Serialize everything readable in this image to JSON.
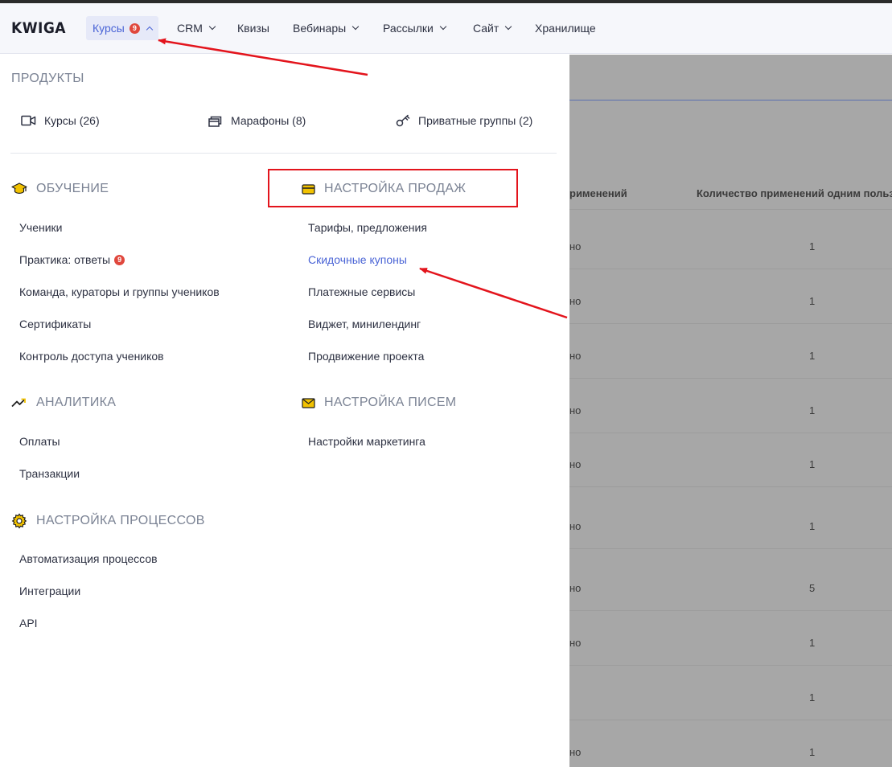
{
  "logo": "KWIGA",
  "nav": {
    "items": [
      {
        "label": "Курсы",
        "badge": "9",
        "active": true,
        "chevron": "up"
      },
      {
        "label": "CRM",
        "chevron": "down"
      },
      {
        "label": "Квизы"
      },
      {
        "label": "Вебинары",
        "chevron": "down"
      },
      {
        "label": "Рассылки",
        "chevron": "down"
      },
      {
        "label": "Сайт",
        "chevron": "down"
      },
      {
        "label": "Хранилище"
      }
    ]
  },
  "menu": {
    "products_title": "ПРОДУКТЫ",
    "products": [
      {
        "label": "Курсы (26)",
        "icon": "video-camera-icon"
      },
      {
        "label": "Марафоны (8)",
        "icon": "stack-cards-icon"
      },
      {
        "label": "Приватные группы (2)",
        "icon": "key-icon"
      }
    ],
    "learning": {
      "title": "ОБУЧЕНИЕ",
      "icon": "graduation-cap-icon",
      "items": [
        "Ученики",
        "Практика: ответы",
        "Команда, кураторы и группы учеников",
        "Сертификаты",
        "Контроль доступа учеников"
      ],
      "practice_badge": "9"
    },
    "sales": {
      "title": "НАСТРОЙКА ПРОДАЖ",
      "icon": "credit-card-icon",
      "items": [
        "Тарифы, предложения",
        "Скидочные купоны",
        "Платежные сервисы",
        "Виджет, минилендинг",
        "Продвижение проекта"
      ]
    },
    "analytics": {
      "title": "АНАЛИТИКА",
      "icon": "trend-up-icon",
      "items": [
        "Оплаты",
        "Транзакции"
      ]
    },
    "mail": {
      "title": "НАСТРОЙКА ПИСЕМ",
      "icon": "envelope-icon",
      "items": [
        "Настройки маркетинга"
      ]
    },
    "processes": {
      "title": "НАСТРОЙКА ПРОЦЕССОВ",
      "icon": "gear-icon",
      "items": [
        "Автоматизация процессов",
        "Интеграции",
        "API"
      ]
    }
  },
  "background_table": {
    "headers": [
      "рименений",
      "Количество применений одним пользов"
    ],
    "rows": [
      {
        "c1": "но",
        "c2": "1"
      },
      {
        "c1": "но",
        "c2": "1"
      },
      {
        "c1": "но",
        "c2": "1"
      },
      {
        "c1": "но",
        "c2": "1"
      },
      {
        "c1": "но",
        "c2": "1"
      },
      {
        "c1": "но",
        "c2": "1"
      },
      {
        "c1": "но",
        "c2": "5"
      },
      {
        "c1": "но",
        "c2": "1"
      },
      {
        "c1": "",
        "c2": "1"
      },
      {
        "c1": "но",
        "c2": "1"
      }
    ]
  },
  "colors": {
    "accent": "#4a64d6",
    "badge": "#e0473d",
    "icon_yellow": "#f2c200",
    "annotation_red": "#e3141c"
  }
}
